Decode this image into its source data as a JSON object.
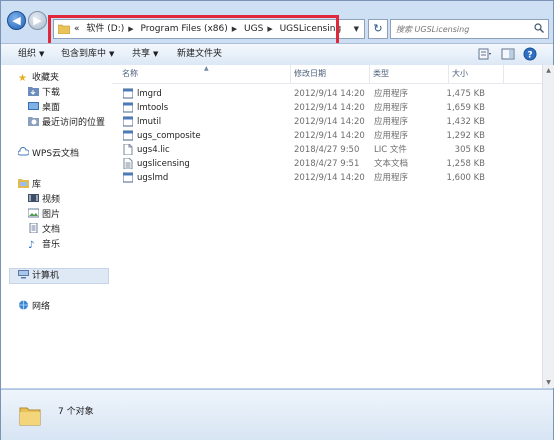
{
  "address": {
    "segments": [
      "«",
      "软件 (D:)",
      "Program Files (x86)",
      "UGS",
      "UGSLicensing"
    ]
  },
  "search": {
    "placeholder": "搜索 UGSLicensing"
  },
  "toolbar": {
    "organize": "组织",
    "include_in_library": "包含到库中",
    "share": "共享",
    "new_folder": "新建文件夹"
  },
  "sidebar": {
    "favorites": "收藏夹",
    "downloads": "下载",
    "desktop": "桌面",
    "recent": "最近访问的位置",
    "wps": "WPS云文档",
    "libraries": "库",
    "videos": "视频",
    "pictures": "图片",
    "documents": "文档",
    "music": "音乐",
    "computer": "计算机",
    "network": "网络"
  },
  "columns": {
    "name": "名称",
    "modified": "修改日期",
    "type": "类型",
    "size": "大小"
  },
  "files": [
    {
      "name": "lmgrd",
      "modified": "2012/9/14 14:20",
      "type": "应用程序",
      "size": "1,475 KB",
      "icon": "application-icon"
    },
    {
      "name": "lmtools",
      "modified": "2012/9/14 14:20",
      "type": "应用程序",
      "size": "1,659 KB",
      "icon": "application-icon"
    },
    {
      "name": "lmutil",
      "modified": "2012/9/14 14:20",
      "type": "应用程序",
      "size": "1,432 KB",
      "icon": "application-icon"
    },
    {
      "name": "ugs_composite",
      "modified": "2012/9/14 14:20",
      "type": "应用程序",
      "size": "1,292 KB",
      "icon": "application-icon"
    },
    {
      "name": "ugs4.lic",
      "modified": "2018/4/27 9:50",
      "type": "LIC 文件",
      "size": "305 KB",
      "icon": "file-icon"
    },
    {
      "name": "ugslicensing",
      "modified": "2018/4/27 9:51",
      "type": "文本文档",
      "size": "1,258 KB",
      "icon": "text-document-icon"
    },
    {
      "name": "ugslmd",
      "modified": "2012/9/14 14:20",
      "type": "应用程序",
      "size": "1,600 KB",
      "icon": "application-icon"
    }
  ],
  "status": {
    "count": "7 个对象"
  },
  "colors": {
    "highlight_box": "#e0283a",
    "selection": "#dfe9f5"
  }
}
